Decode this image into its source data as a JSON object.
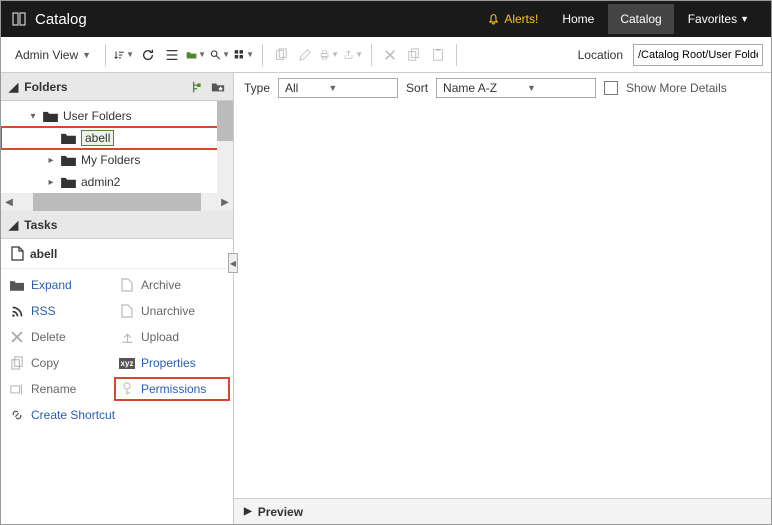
{
  "topbar": {
    "title": "Catalog",
    "alerts": "Alerts!",
    "nav": {
      "home": "Home",
      "catalog": "Catalog",
      "favorites": "Favorites"
    }
  },
  "toolbar": {
    "view_label": "Admin View",
    "location_label": "Location",
    "location_value": "/Catalog Root/User Folder"
  },
  "folders": {
    "header": "Folders",
    "items": [
      {
        "label": "User Folders",
        "indent": 1,
        "expanded": true,
        "expander": "▾"
      },
      {
        "label": "abell",
        "indent": 2,
        "highlighted": true,
        "expander": ""
      },
      {
        "label": "My Folders",
        "indent": 2,
        "expander": "▸"
      },
      {
        "label": "admin2",
        "indent": 2,
        "expander": "▸"
      }
    ]
  },
  "tasks": {
    "header": "Tasks",
    "file": "abell",
    "items": [
      {
        "label": "Expand",
        "col": 1,
        "blue": true,
        "icon": "folder"
      },
      {
        "label": "Archive",
        "col": 2,
        "blue": false,
        "icon": "doc"
      },
      {
        "label": "RSS",
        "col": 1,
        "blue": true,
        "icon": "rss"
      },
      {
        "label": "Unarchive",
        "col": 2,
        "blue": false,
        "icon": "doc"
      },
      {
        "label": "Delete",
        "col": 1,
        "blue": false,
        "icon": "x"
      },
      {
        "label": "Upload",
        "col": 2,
        "blue": false,
        "icon": "up"
      },
      {
        "label": "Copy",
        "col": 1,
        "blue": false,
        "icon": "copy"
      },
      {
        "label": "Properties",
        "col": 2,
        "blue": true,
        "icon": "xyz"
      },
      {
        "label": "Rename",
        "col": 1,
        "blue": false,
        "icon": "rename"
      },
      {
        "label": "Permissions",
        "col": 2,
        "blue": true,
        "icon": "key",
        "highlighted": true
      },
      {
        "label": "Create Shortcut",
        "col": 1,
        "blue": true,
        "icon": "link",
        "full": true
      }
    ]
  },
  "filter": {
    "type_label": "Type",
    "type_value": "All",
    "sort_label": "Sort",
    "sort_value": "Name A-Z",
    "show_more": "Show More Details"
  },
  "preview": {
    "label": "Preview"
  }
}
